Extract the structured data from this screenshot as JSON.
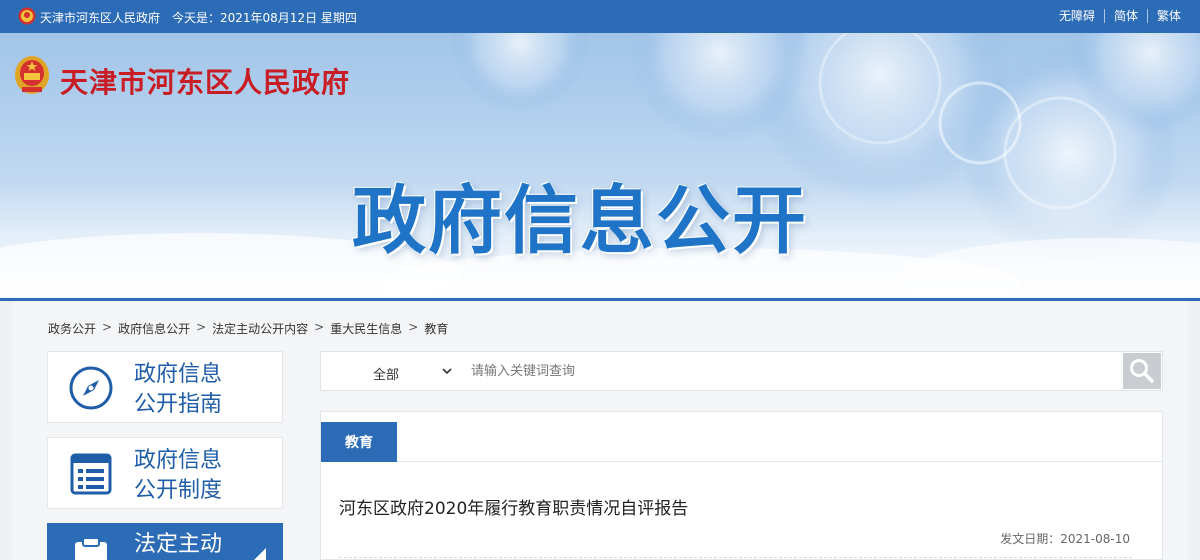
{
  "topbar": {
    "site_name": "天津市河东区人民政府",
    "date_text": "今天是：2021年08月12日 星期四",
    "links": [
      "无障碍",
      "简体",
      "繁体"
    ]
  },
  "banner": {
    "gov_title": "天津市河东区人民政府",
    "big_title": "政府信息公开"
  },
  "breadcrumb": [
    "政务公开",
    "政府信息公开",
    "法定主动公开内容",
    "重大民生信息",
    "教育"
  ],
  "sidebar": {
    "items": [
      {
        "line1": "政府信息",
        "line2": "公开指南",
        "icon": "compass-icon"
      },
      {
        "line1": "政府信息",
        "line2": "公开制度",
        "icon": "document-list-icon"
      },
      {
        "line1": "法定主动",
        "line2": "",
        "icon": "clipboard-icon"
      }
    ]
  },
  "search": {
    "scope_value": "全部",
    "placeholder": "请输入关键词查询"
  },
  "section": {
    "tab_label": "教育",
    "article_title": "河东区政府2020年履行教育职责情况自评报告",
    "publish_date": "发文日期：2021-08-10"
  },
  "colors": {
    "primary": "#2c6bb5",
    "emblem_red": "#c81d25",
    "big_title_blue": "#1f74c8"
  }
}
